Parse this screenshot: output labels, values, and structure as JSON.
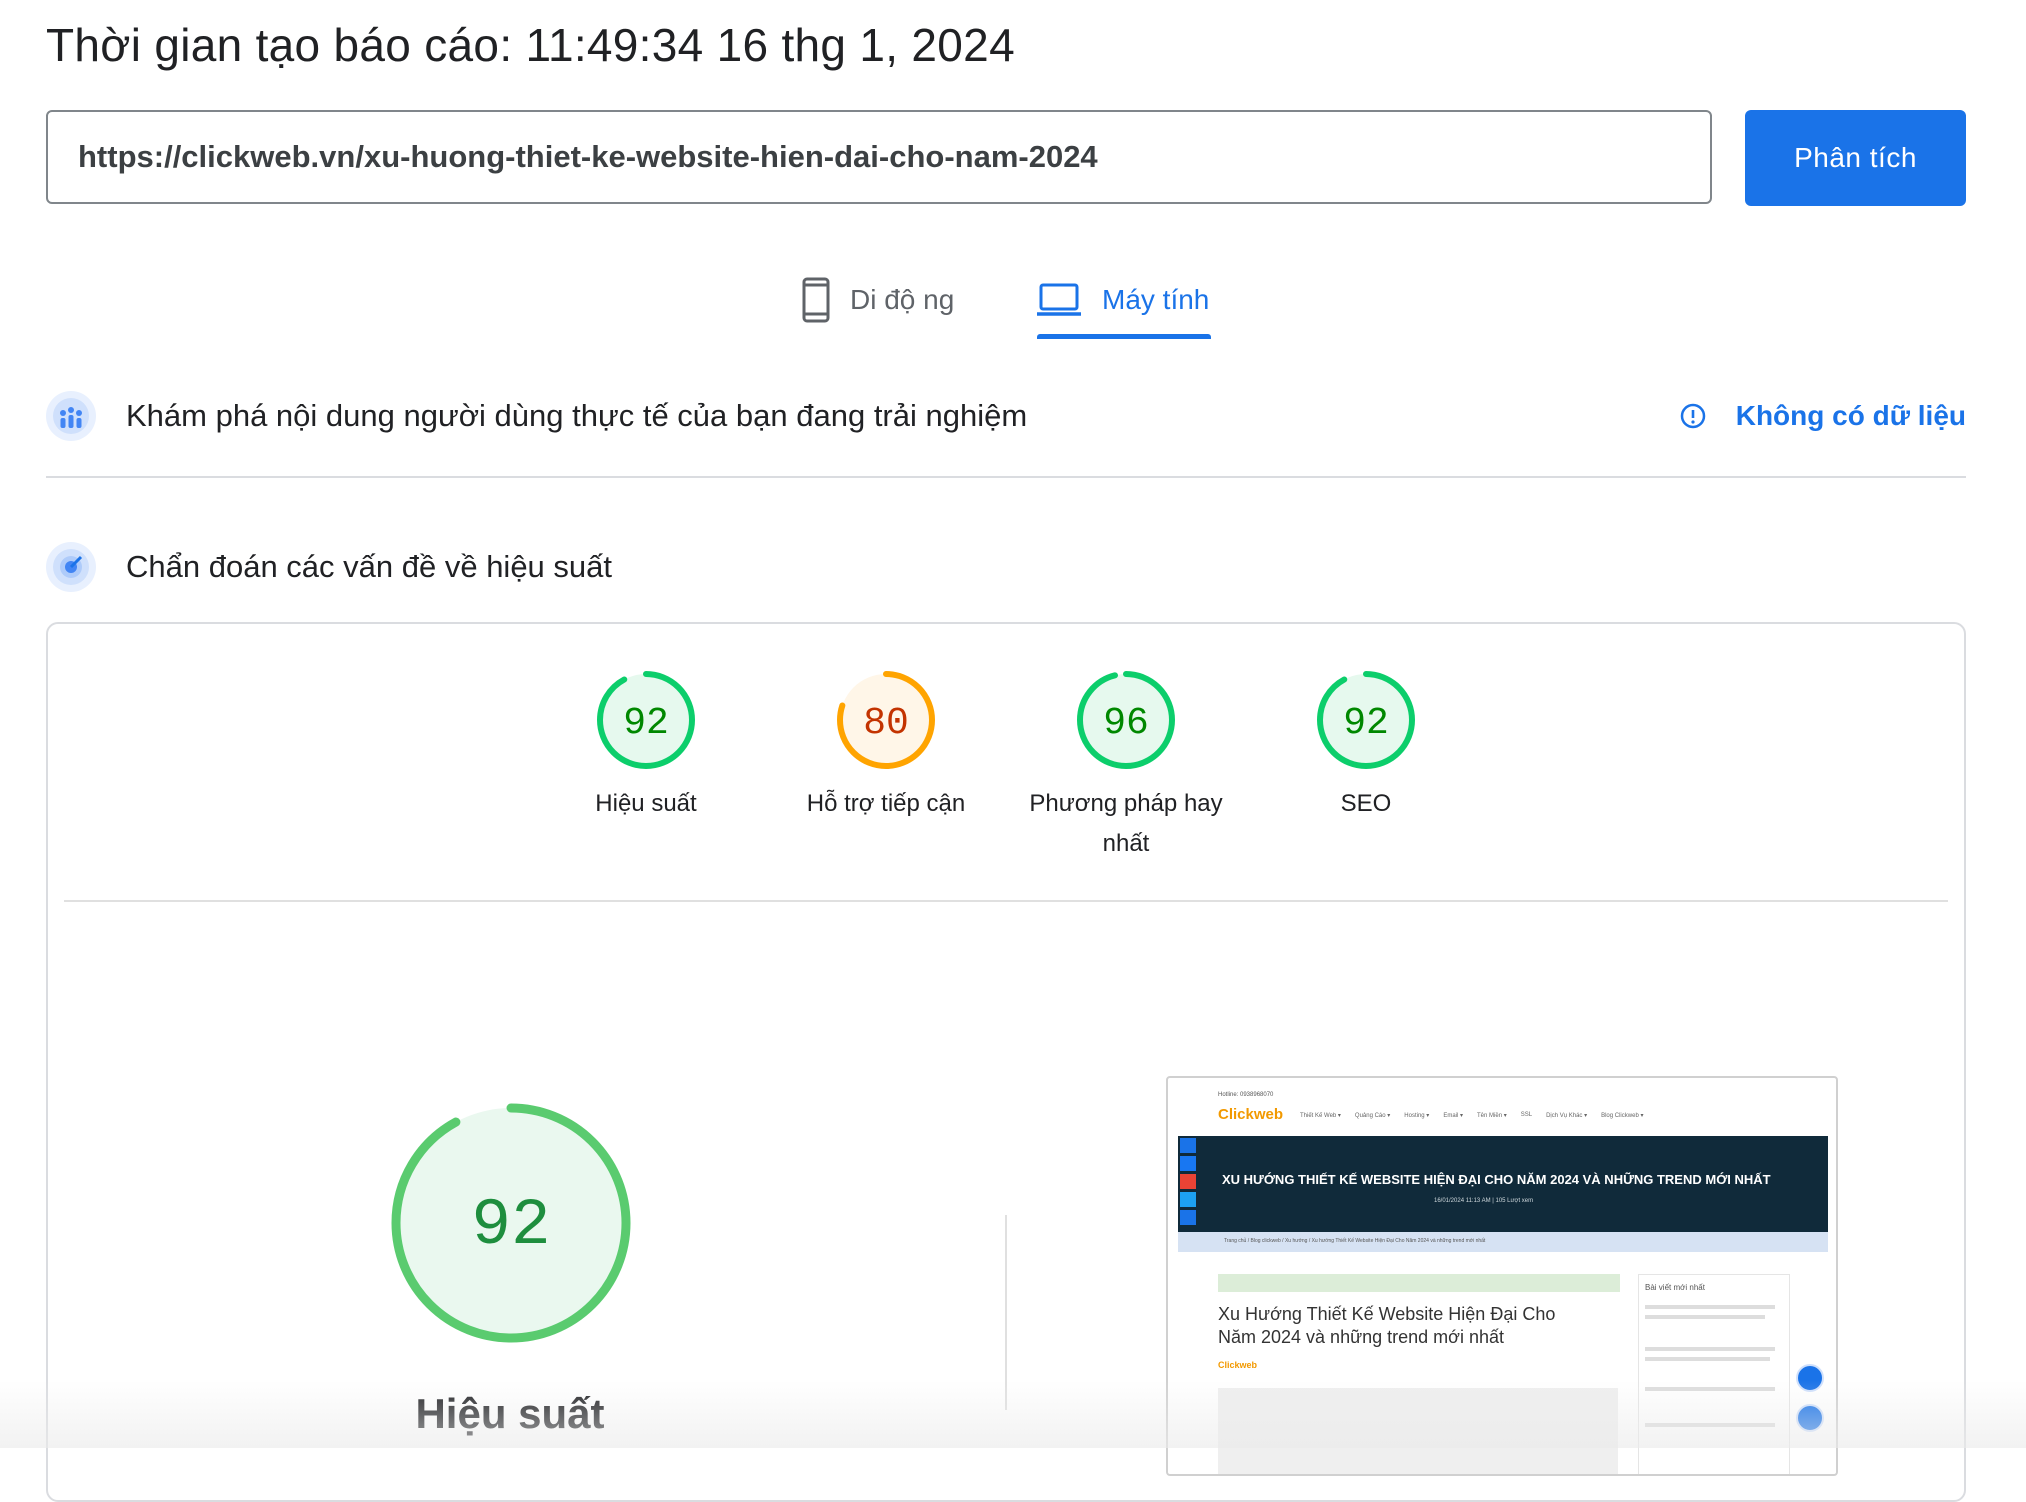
{
  "header": {
    "report_time": "Thời gian tạo báo cáo: 11:49:34 16 thg 1, 2024"
  },
  "url_input": {
    "value": "https://clickweb.vn/xu-huong-thiet-ke-website-hien-dai-cho-nam-2024"
  },
  "analyze_button": {
    "label": "Phân tích"
  },
  "device_tabs": [
    {
      "label": "Di độ ng",
      "icon": "phone-icon",
      "selected": false
    },
    {
      "label": "Máy tính",
      "icon": "laptop-icon",
      "selected": true
    }
  ],
  "field_data": {
    "title": "Khám phá nội dung người dùng thực tế của bạn đang trải nghiệm",
    "status": "Không có dữ liệu",
    "status_icon": "info-icon"
  },
  "diagnose": {
    "title": "Chẩn đoán các vấn đề về hiệu suất"
  },
  "scores": [
    {
      "value": "92",
      "label": "Hiệu suất",
      "rating": "pass"
    },
    {
      "value": "80",
      "label": "Hỗ trợ tiếp cận",
      "rating": "average"
    },
    {
      "value": "96",
      "label": "Phương pháp hay nhất",
      "rating": "pass"
    },
    {
      "value": "92",
      "label": "SEO",
      "rating": "pass"
    }
  ],
  "performance": {
    "score": "92",
    "title": "Hiệu suất"
  },
  "screenshot": {
    "hotline": "Hotline: 0938968070",
    "logo": "Clickweb",
    "nav": [
      "Thiết Kế Web ▾",
      "Quảng Cáo ▾",
      "Hosting ▾",
      "Email ▾",
      "Tên Miền ▾",
      "SSL",
      "Dịch Vụ Khác ▾",
      "Blog Clickweb ▾"
    ],
    "banner_title": "XU HƯỚNG THIẾT KẾ WEBSITE HIỆN ĐẠI CHO NĂM 2024 VÀ NHỮNG TREND MỚI NHẤT",
    "banner_meta": "16/01/2024 11:13 AM  |  105 Lượt xem",
    "breadcrumb": "Trang chủ / Blog clickweb / Xu hướng / Xu hướng Thiết Kế Website Hiện Đại Cho Năm 2024 và những trend mới nhất",
    "article_title_line1": "Xu Hướng Thiết Kế Website Hiện Đại Cho",
    "article_title_line2": "Năm 2024 và những trend mới nhất",
    "sidebar_title": "Bài viết mới nhất"
  },
  "colors": {
    "pass": "#0cce6b",
    "pass_text": "#008800",
    "average": "#ffa400",
    "average_text": "#c33300",
    "accent": "#1a73e8"
  }
}
